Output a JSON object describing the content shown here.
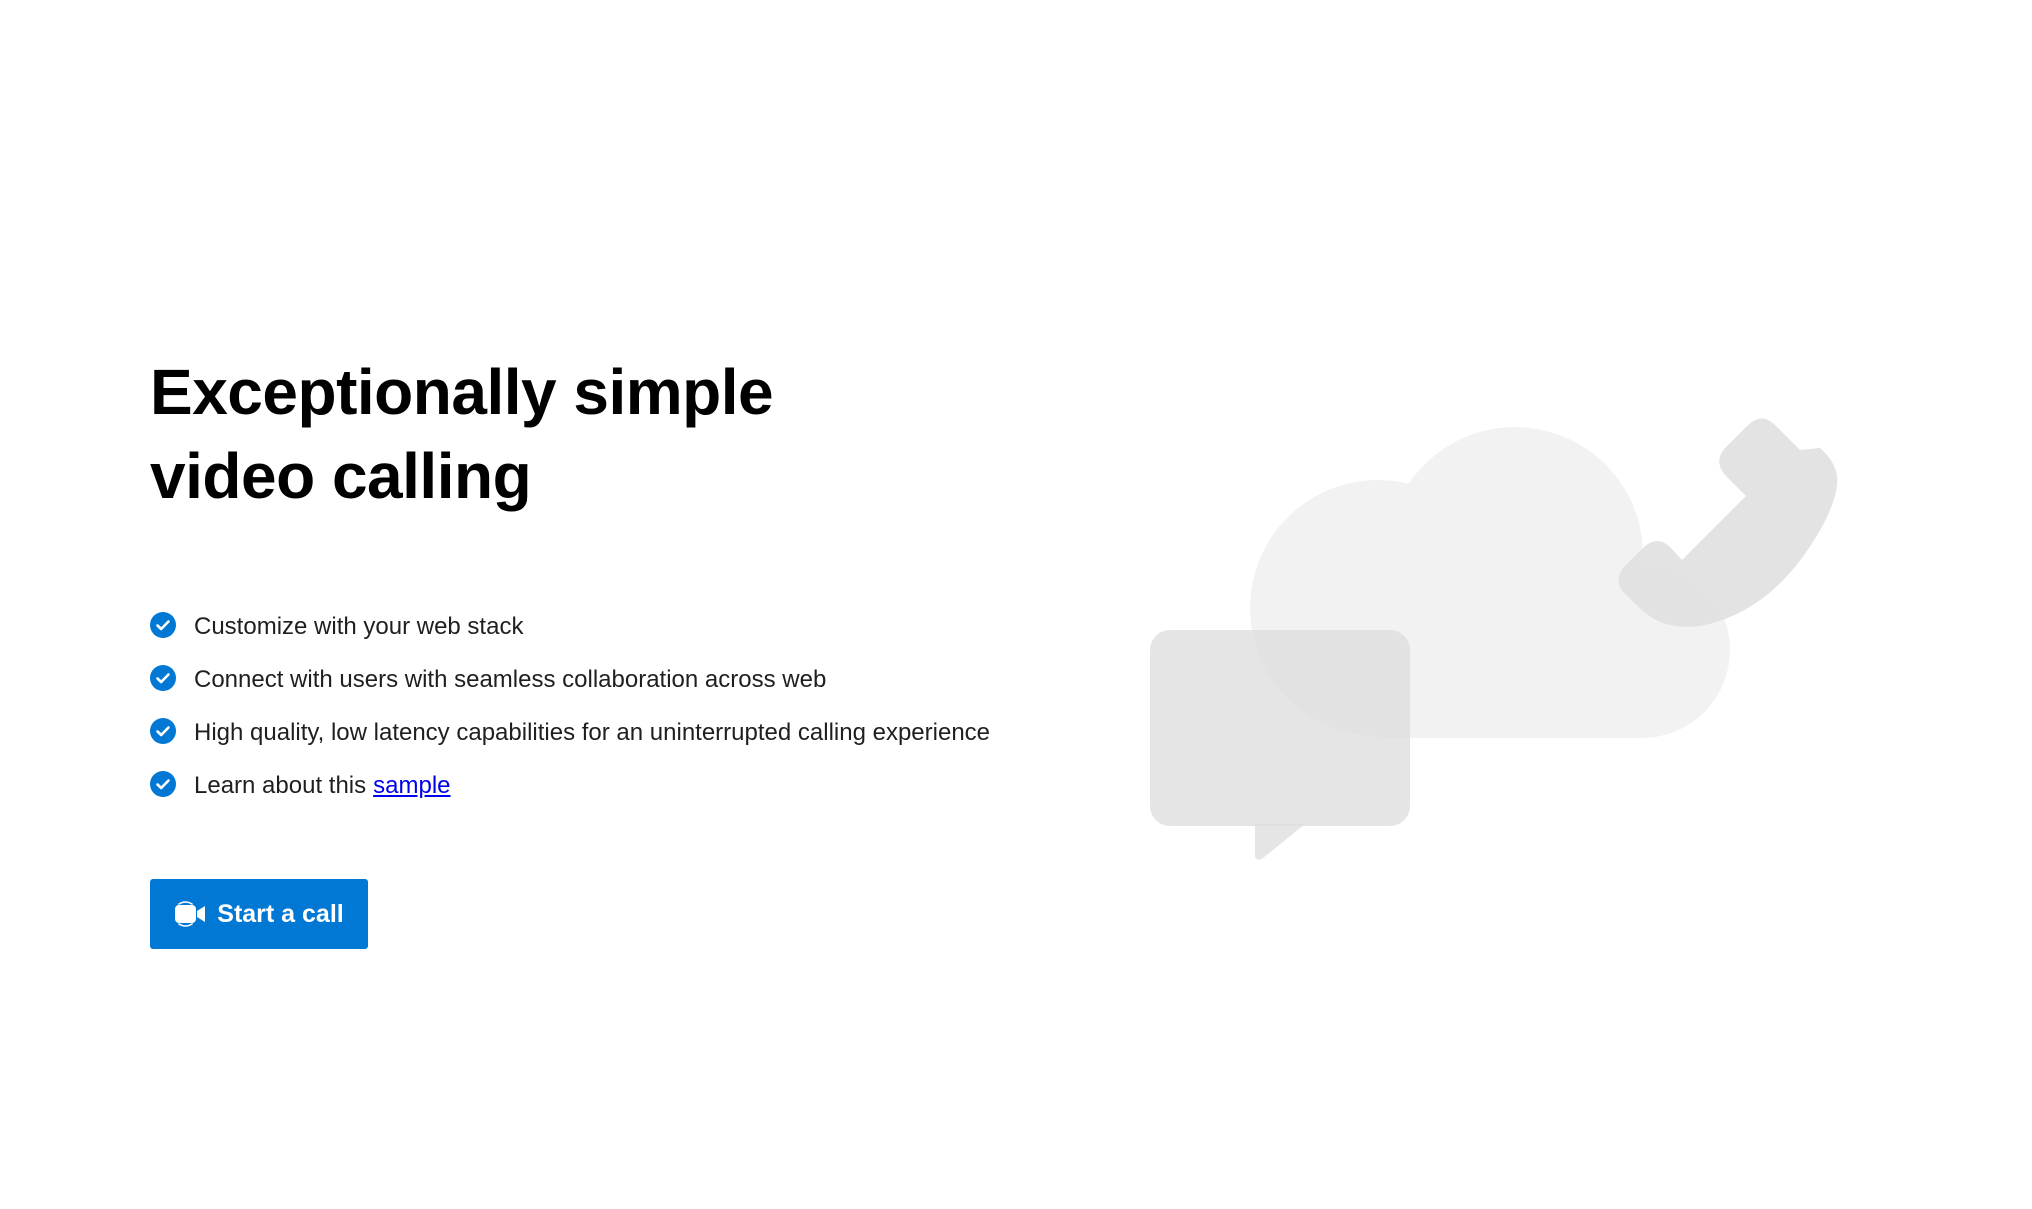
{
  "hero": {
    "title": "Exceptionally simple video calling"
  },
  "features": [
    {
      "text": "Customize with your web stack",
      "icon": "check-circle-icon"
    },
    {
      "text": "Connect with users with seamless collaboration across web",
      "icon": "check-circle-icon"
    },
    {
      "text": "High quality, low latency capabilities for an uninterrupted calling experience",
      "icon": "check-circle-icon"
    },
    {
      "text": "Learn about this",
      "link_text": "sample",
      "icon": "check-circle-icon"
    }
  ],
  "start_button": {
    "label": "Start a call",
    "icon": "video-camera-icon"
  },
  "colors": {
    "accent": "#0078d4",
    "link": "#0000ee",
    "illustration_light": "#f2f2f2",
    "illustration_mid": "#e3e3e3"
  },
  "illustration": {
    "icons": [
      "cloud-icon",
      "chat-bubble-icon",
      "phone-icon"
    ]
  }
}
